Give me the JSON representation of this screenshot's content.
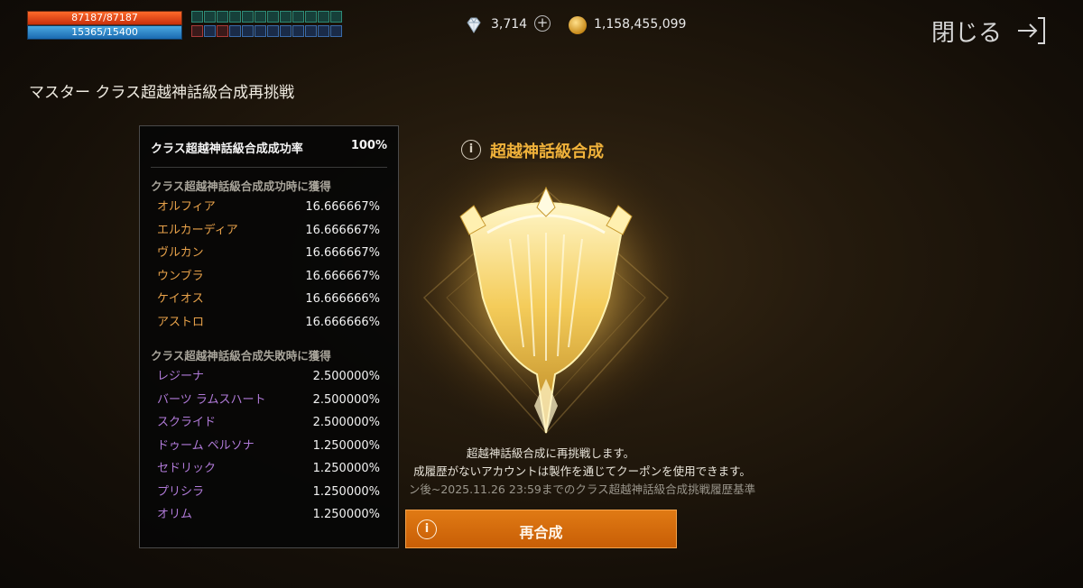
{
  "status": {
    "hp": "87187/87187",
    "mp": "15365/15400"
  },
  "currency": {
    "diamond_icon": "diamond-icon",
    "diamonds": "3,714",
    "plus_icon": "+",
    "gold_icon": "gold-coin-icon",
    "gold": "1,158,455,099"
  },
  "close": {
    "label": "閉じる",
    "icon": "exit-arrow-icon"
  },
  "page_title": "マスター クラス超越神話級合成再挑戦",
  "panel": {
    "rate_label": "クラス超越神話級合成成功率",
    "rate_value": "100%",
    "success_head": "クラス超越神話級合成成功時に獲得",
    "success_items": [
      {
        "name": "オルフィア",
        "value": "16.666667%"
      },
      {
        "name": "エルカーディア",
        "value": "16.666667%"
      },
      {
        "name": "ヴルカン",
        "value": "16.666667%"
      },
      {
        "name": "ウンブラ",
        "value": "16.666667%"
      },
      {
        "name": "ケイオス",
        "value": "16.666666%"
      },
      {
        "name": "アストロ",
        "value": "16.666666%"
      }
    ],
    "fail_head": "クラス超越神話級合成失敗時に獲得",
    "fail_items": [
      {
        "name": "レジーナ",
        "value": "2.500000%"
      },
      {
        "name": "バーツ ラムスハート",
        "value": "2.500000%"
      },
      {
        "name": "スクライド",
        "value": "2.500000%"
      },
      {
        "name": "ドゥーム ペルソナ",
        "value": "1.250000%"
      },
      {
        "name": "セドリック",
        "value": "1.250000%"
      },
      {
        "name": "プリシラ",
        "value": "1.250000%"
      },
      {
        "name": "オリム",
        "value": "1.250000%"
      }
    ]
  },
  "synthesis": {
    "title": "超越神話級合成",
    "notice1": "超越神話級合成に再挑戦します。",
    "notice2": "成履歴がないアカウントは製作を通じてクーポンを使用できます。",
    "notice3": "ン後~2025.11.26 23:59までのクラス超越神話級合成挑戦履歴基準",
    "button_label": "再合成",
    "info_glyph": "i"
  },
  "colors": {
    "accent_gold": "#f0b23a",
    "button_orange": "#d86a0c",
    "success_name": "#e8a24a",
    "fail_name": "#b07ad8"
  }
}
